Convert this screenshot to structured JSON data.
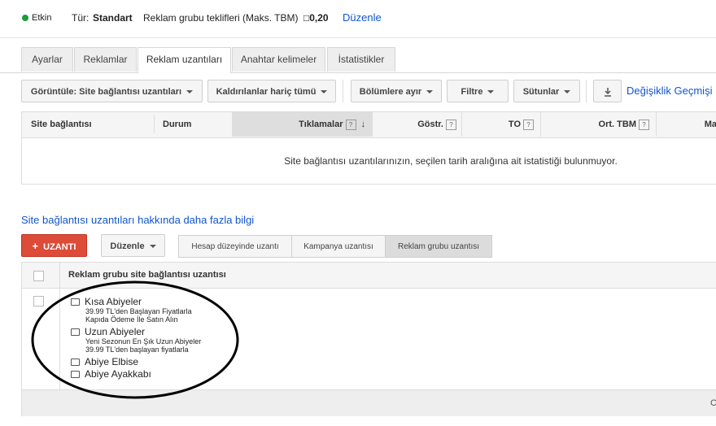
{
  "status": {
    "label": "Etkin",
    "color": "#1a9e3a"
  },
  "header": {
    "type_label": "Tür:",
    "type_value": "Standart",
    "bid_label": "Reklam grubu teklifleri (Maks. TBM)",
    "bid_value": "□0,20",
    "edit_link": "Düzenle"
  },
  "tabs": [
    {
      "label": "Ayarlar"
    },
    {
      "label": "Reklamlar"
    },
    {
      "label": "Reklam uzantıları"
    },
    {
      "label": "Anahtar kelimeler"
    },
    {
      "label": "İstatistikler"
    }
  ],
  "toolbar": {
    "view": "Görüntüle: Site bağlantısı uzantıları",
    "removed": "Kaldırılanlar hariç tümü",
    "segments": "Bölümlere ayır",
    "filter": "Filtre",
    "columns": "Sütunlar",
    "history": "Değişiklik Geçmişi"
  },
  "stats_table": {
    "columns": [
      "Site bağlantısı",
      "Durum",
      "Tıklamalar",
      "Göstr.",
      "TO",
      "Ort. TBM",
      "Ma"
    ],
    "help_glyph": "?",
    "sort_glyph": "↓",
    "empty_message": "Site bağlantısı uzantılarınızın, seçilen tarih aralığına ait istatistiği bulunmuyor."
  },
  "info_link": "Site bağlantısı uzantıları hakkında daha fazla bilgi",
  "actions": {
    "add_label": "UZANTI",
    "add_glyph": "+",
    "add_color": "#dd4b39",
    "edit_label": "Düzenle",
    "levels": [
      "Hesap düzeyinde uzantı",
      "Kampanya uzantısı",
      "Reklam grubu uzantısı"
    ]
  },
  "ext_table": {
    "header": "Reklam grubu site bağlantısı uzantısı",
    "items": [
      {
        "title": "Kısa Abiyeler",
        "lines": [
          "39.99 TL'den Başlayan Fiyatlarla",
          "Kapıda Ödeme İle Satın Alın"
        ]
      },
      {
        "title": "Uzun Abiyeler",
        "lines": [
          "Yeni Sezonun En Şık Uzun Abiyeler",
          "39.99 TL'den başlayan fiyatlarla"
        ]
      },
      {
        "title": "Abiye Elbise",
        "lines": []
      },
      {
        "title": "Abiye Ayakkabı",
        "lines": []
      }
    ],
    "footer_glyph": "C"
  },
  "colors": {
    "link": "#1155cc",
    "accent": "#dd4b39",
    "active_segment": "#dcdcdc"
  }
}
